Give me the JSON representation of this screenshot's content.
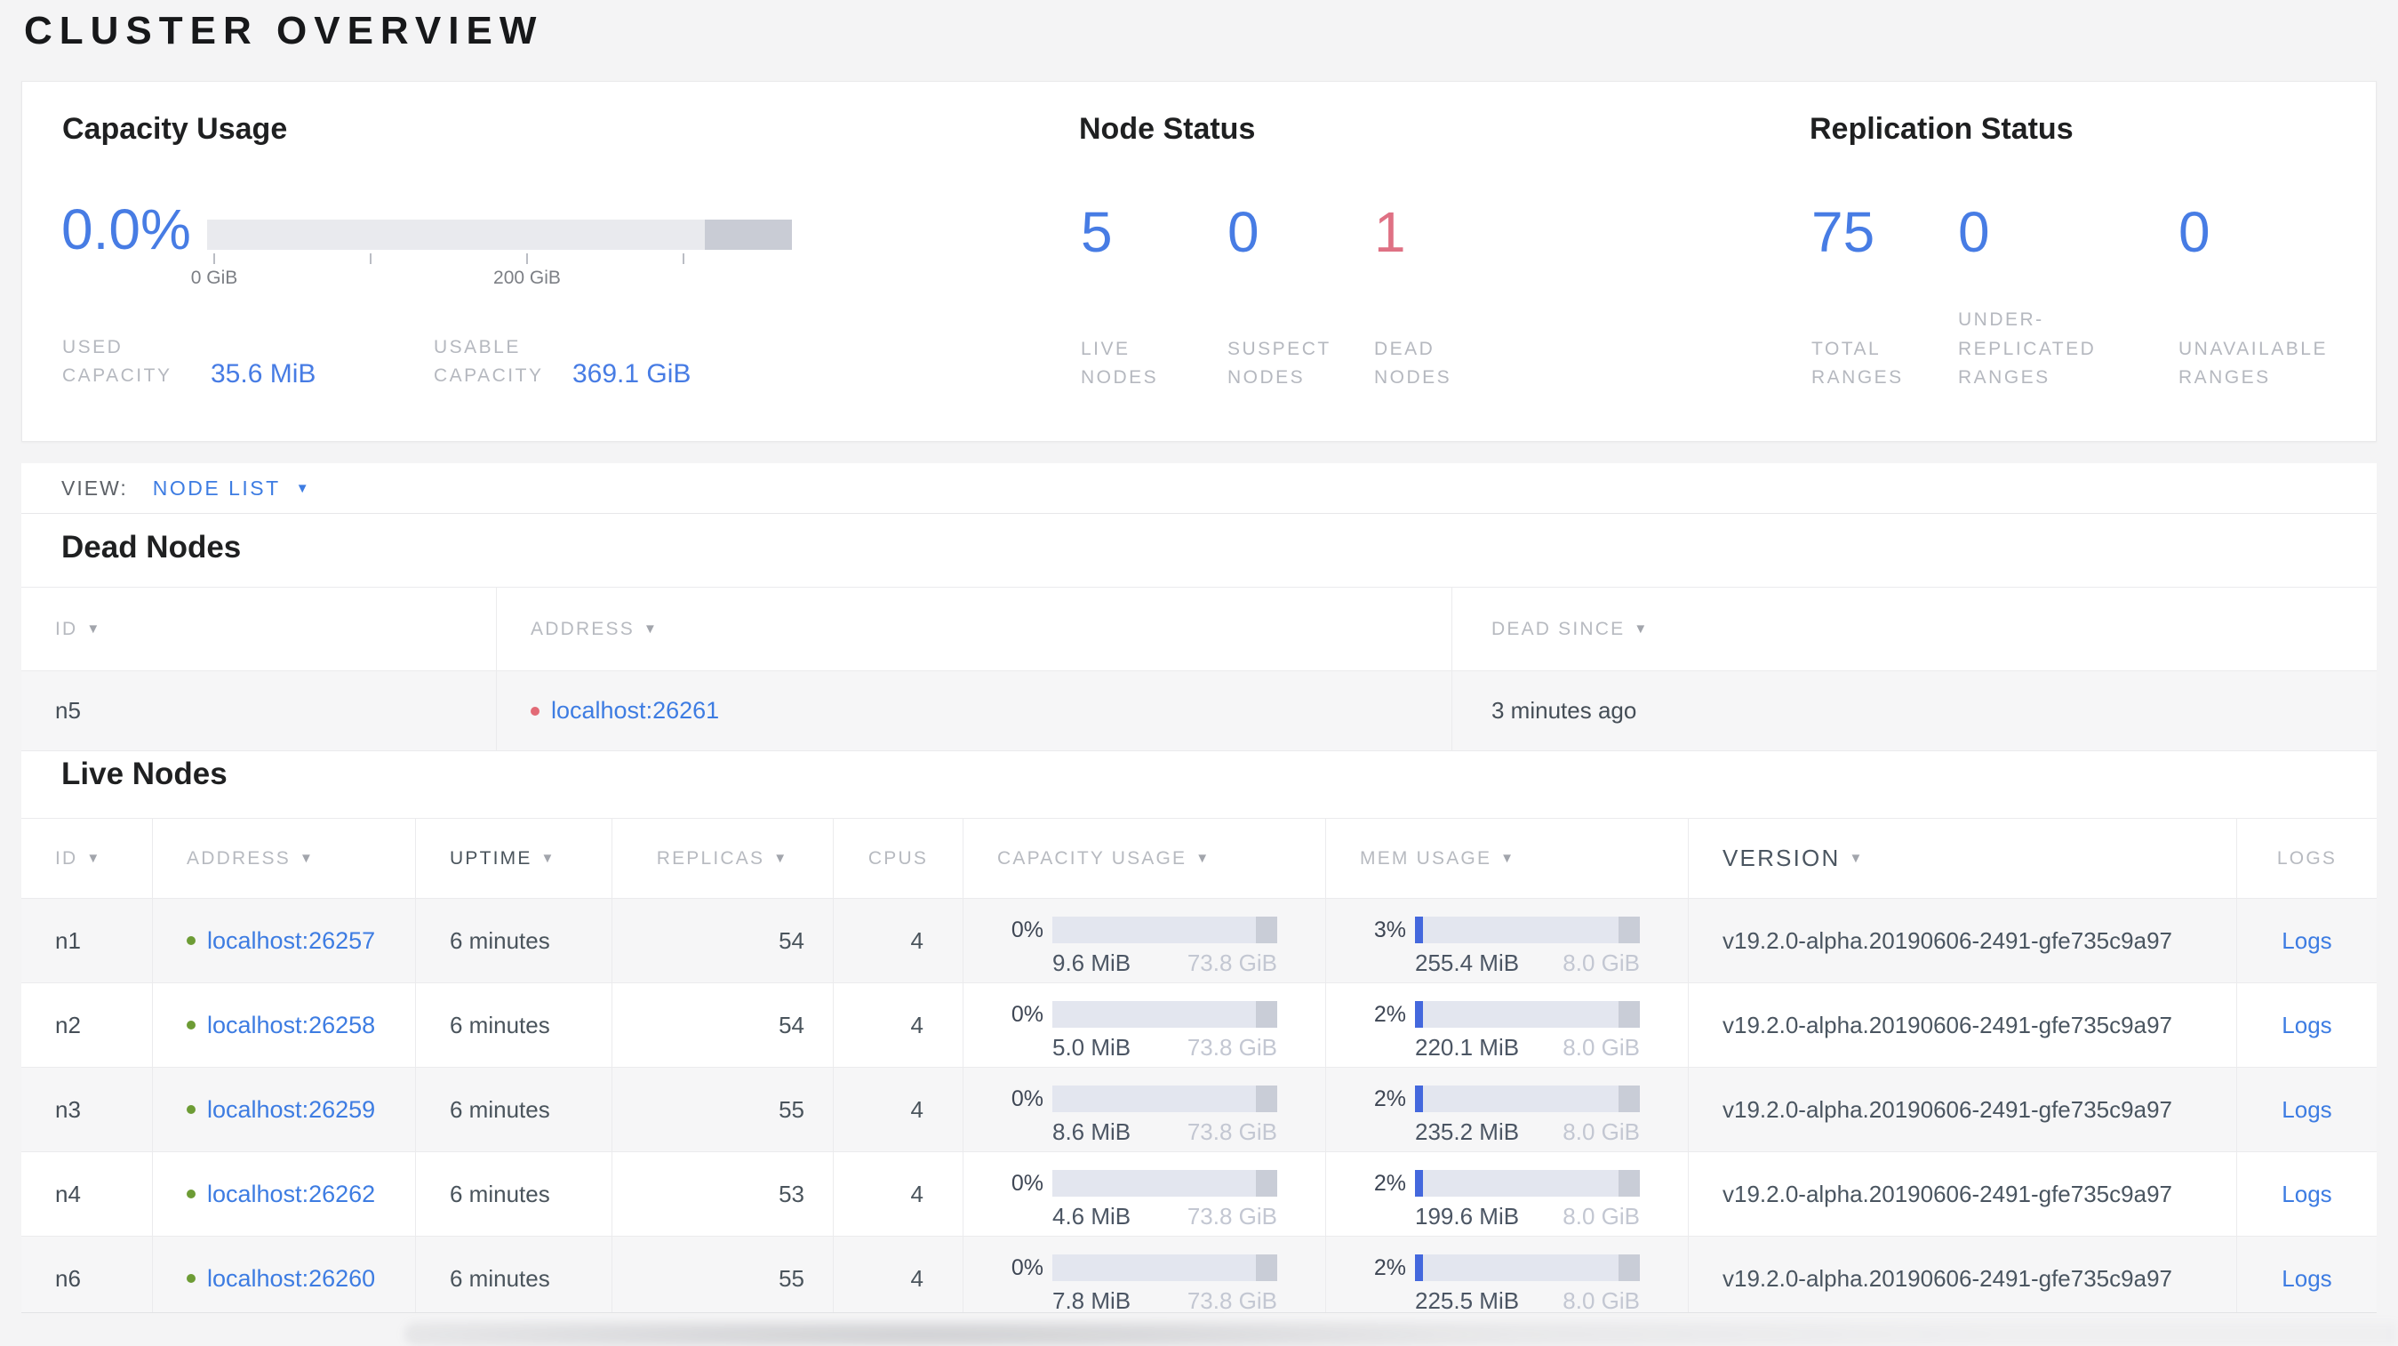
{
  "colors": {
    "accent_blue": "#477ce4",
    "link_blue": "#3d7ce2",
    "danger_red": "#df7184",
    "live_green": "#6d9c35",
    "dead_red": "#e26a76",
    "bar_blue": "#4468dd"
  },
  "page": {
    "title": "CLUSTER OVERVIEW"
  },
  "summary": {
    "capacity": {
      "title": "Capacity Usage",
      "percent": "0.0%",
      "tick_labels": [
        "0 GiB",
        "200 GiB"
      ],
      "stats": [
        {
          "label": "USED CAPACITY",
          "value": "35.6 MiB"
        },
        {
          "label": "USABLE CAPACITY",
          "value": "369.1 GiB"
        }
      ]
    },
    "node_status": {
      "title": "Node Status",
      "stats": [
        {
          "value": "5",
          "label": "LIVE NODES"
        },
        {
          "value": "0",
          "label": "SUSPECT NODES"
        },
        {
          "value": "1",
          "label": "DEAD NODES"
        }
      ]
    },
    "replication": {
      "title": "Replication Status",
      "stats": [
        {
          "value": "75",
          "label": "TOTAL RANGES"
        },
        {
          "value": "0",
          "label": "UNDER-REPLICATED RANGES"
        },
        {
          "value": "0",
          "label": "UNAVAILABLE RANGES"
        }
      ]
    }
  },
  "view_bar": {
    "label": "VIEW:",
    "selected": "NODE LIST"
  },
  "dead_nodes": {
    "title": "Dead Nodes",
    "columns": [
      {
        "label": "ID",
        "sortable": true
      },
      {
        "label": "ADDRESS",
        "sortable": true
      },
      {
        "label": "DEAD SINCE",
        "sortable": true
      }
    ],
    "rows": [
      {
        "id": "n5",
        "address": "localhost:26261",
        "dead_since": "3 minutes ago"
      }
    ]
  },
  "live_nodes": {
    "title": "Live Nodes",
    "columns": [
      {
        "label": "ID",
        "sortable": true
      },
      {
        "label": "ADDRESS",
        "sortable": true
      },
      {
        "label": "UPTIME",
        "sortable": true
      },
      {
        "label": "REPLICAS",
        "sortable": true
      },
      {
        "label": "CPUS",
        "sortable": false
      },
      {
        "label": "CAPACITY USAGE",
        "sortable": true
      },
      {
        "label": "MEM USAGE",
        "sortable": true
      },
      {
        "label": "VERSION",
        "sortable": true
      },
      {
        "label": "LOGS",
        "sortable": false
      }
    ],
    "rows": [
      {
        "id": "n1",
        "address": "localhost:26257",
        "uptime": "6 minutes",
        "replicas": "54",
        "cpus": "4",
        "capacity": {
          "pct_label": "0%",
          "pct": 0,
          "used": "9.6 MiB",
          "total": "73.8 GiB"
        },
        "memory": {
          "pct_label": "3%",
          "pct": 3,
          "used": "255.4 MiB",
          "total": "8.0 GiB"
        },
        "version": "v19.2.0-alpha.20190606-2491-gfe735c9a97",
        "logs_label": "Logs"
      },
      {
        "id": "n2",
        "address": "localhost:26258",
        "uptime": "6 minutes",
        "replicas": "54",
        "cpus": "4",
        "capacity": {
          "pct_label": "0%",
          "pct": 0,
          "used": "5.0 MiB",
          "total": "73.8 GiB"
        },
        "memory": {
          "pct_label": "2%",
          "pct": 2,
          "used": "220.1 MiB",
          "total": "8.0 GiB"
        },
        "version": "v19.2.0-alpha.20190606-2491-gfe735c9a97",
        "logs_label": "Logs"
      },
      {
        "id": "n3",
        "address": "localhost:26259",
        "uptime": "6 minutes",
        "replicas": "55",
        "cpus": "4",
        "capacity": {
          "pct_label": "0%",
          "pct": 0,
          "used": "8.6 MiB",
          "total": "73.8 GiB"
        },
        "memory": {
          "pct_label": "2%",
          "pct": 2,
          "used": "235.2 MiB",
          "total": "8.0 GiB"
        },
        "version": "v19.2.0-alpha.20190606-2491-gfe735c9a97",
        "logs_label": "Logs"
      },
      {
        "id": "n4",
        "address": "localhost:26262",
        "uptime": "6 minutes",
        "replicas": "53",
        "cpus": "4",
        "capacity": {
          "pct_label": "0%",
          "pct": 0,
          "used": "4.6 MiB",
          "total": "73.8 GiB"
        },
        "memory": {
          "pct_label": "2%",
          "pct": 2,
          "used": "199.6 MiB",
          "total": "8.0 GiB"
        },
        "version": "v19.2.0-alpha.20190606-2491-gfe735c9a97",
        "logs_label": "Logs"
      },
      {
        "id": "n6",
        "address": "localhost:26260",
        "uptime": "6 minutes",
        "replicas": "55",
        "cpus": "4",
        "capacity": {
          "pct_label": "0%",
          "pct": 0,
          "used": "7.8 MiB",
          "total": "73.8 GiB"
        },
        "memory": {
          "pct_label": "2%",
          "pct": 2,
          "used": "225.5 MiB",
          "total": "8.0 GiB"
        },
        "version": "v19.2.0-alpha.20190606-2491-gfe735c9a97",
        "logs_label": "Logs"
      }
    ]
  }
}
